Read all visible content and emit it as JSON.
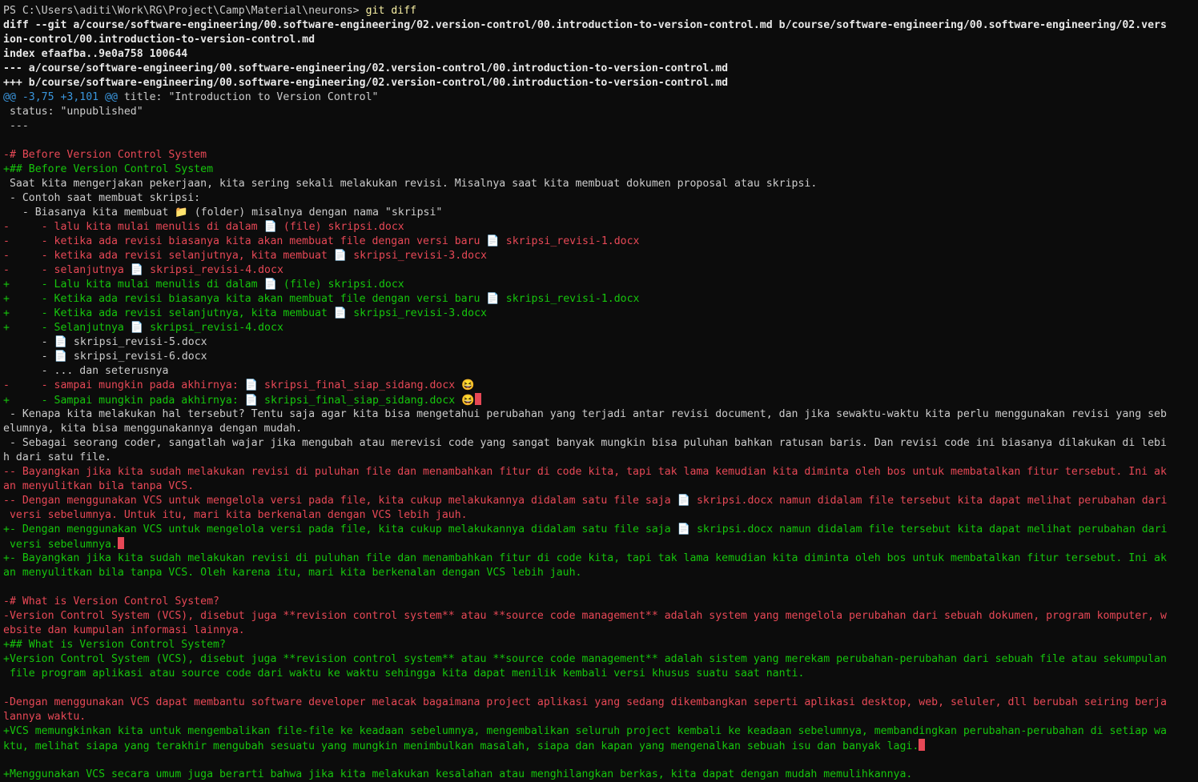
{
  "theme": {
    "background": "#0c0c0c",
    "foreground": "#cccccc",
    "command": "#f9f1a5",
    "hunk": "#3a96dd",
    "deleted": "#e74856",
    "added": "#16c60c"
  },
  "lines": [
    {
      "type": "prompt",
      "prompt": "PS C:\\Users\\aditi\\Work\\RG\\Project\\Camp\\Material\\neurons> ",
      "cmd": "git diff"
    },
    {
      "type": "meta",
      "text": "diff --git a/course/software-engineering/00.software-engineering/02.version-control/00.introduction-to-version-control.md b/course/software-engineering/00.software-engineering/02.vers"
    },
    {
      "type": "meta",
      "text": "ion-control/00.introduction-to-version-control.md"
    },
    {
      "type": "meta",
      "text": "index efaafba..9e0a758 100644"
    },
    {
      "type": "meta",
      "text": "--- a/course/software-engineering/00.software-engineering/02.version-control/00.introduction-to-version-control.md"
    },
    {
      "type": "meta",
      "text": "+++ b/course/software-engineering/00.software-engineering/02.version-control/00.introduction-to-version-control.md"
    },
    {
      "type": "hunk",
      "hunk": "@@ -3,75 +3,101 @@",
      "text": " title: \"Introduction to Version Control\""
    },
    {
      "type": "ctx",
      "text": " status: \"unpublished\""
    },
    {
      "type": "ctx",
      "text": " ---"
    },
    {
      "type": "ctx",
      "text": ""
    },
    {
      "type": "del",
      "text": "-# Before Version Control System"
    },
    {
      "type": "add",
      "text": "+## Before Version Control System"
    },
    {
      "type": "ctx",
      "text": " Saat kita mengerjakan pekerjaan, kita sering sekali melakukan revisi. Misalnya saat kita membuat dokumen proposal atau skripsi."
    },
    {
      "type": "ctx",
      "text": " - Contoh saat membuat skripsi:"
    },
    {
      "type": "ctx",
      "text": "   - Biasanya kita membuat 📁 (folder) misalnya dengan nama \"skripsi\""
    },
    {
      "type": "del",
      "text": "-     - lalu kita mulai menulis di dalam 📄 (file) skripsi.docx"
    },
    {
      "type": "del",
      "text": "-     - ketika ada revisi biasanya kita akan membuat file dengan versi baru 📄 skripsi_revisi-1.docx"
    },
    {
      "type": "del",
      "text": "-     - ketika ada revisi selanjutnya, kita membuat 📄 skripsi_revisi-3.docx"
    },
    {
      "type": "del",
      "text": "-     - selanjutnya 📄 skripsi_revisi-4.docx"
    },
    {
      "type": "add",
      "text": "+     - Lalu kita mulai menulis di dalam 📄 (file) skripsi.docx"
    },
    {
      "type": "add",
      "text": "+     - Ketika ada revisi biasanya kita akan membuat file dengan versi baru 📄 skripsi_revisi-1.docx"
    },
    {
      "type": "add",
      "text": "+     - Ketika ada revisi selanjutnya, kita membuat 📄 skripsi_revisi-3.docx"
    },
    {
      "type": "add",
      "text": "+     - Selanjutnya 📄 skripsi_revisi-4.docx"
    },
    {
      "type": "ctx",
      "text": "      - 📄 skripsi_revisi-5.docx"
    },
    {
      "type": "ctx",
      "text": "      - 📄 skripsi_revisi-6.docx"
    },
    {
      "type": "ctx",
      "text": "      - ... dan seterusnya"
    },
    {
      "type": "del",
      "text": "-     - sampai mungkin pada akhirnya: 📄 skripsi_final_siap_sidang.docx 😆"
    },
    {
      "type": "add",
      "text": "+     - Sampai mungkin pada akhirnya: 📄 skripsi_final_siap_sidang.docx 😆",
      "ws": true
    },
    {
      "type": "ctx",
      "text": " - Kenapa kita melakukan hal tersebut? Tentu saja agar kita bisa mengetahui perubahan yang terjadi antar revisi document, dan jika sewaktu-waktu kita perlu menggunakan revisi yang seb"
    },
    {
      "type": "ctx",
      "text": "elumnya, kita bisa menggunakannya dengan mudah."
    },
    {
      "type": "ctx",
      "text": " - Sebagai seorang coder, sangatlah wajar jika mengubah atau merevisi code yang sangat banyak mungkin bisa puluhan bahkan ratusan baris. Dan revisi code ini biasanya dilakukan di lebi"
    },
    {
      "type": "ctx",
      "text": "h dari satu file."
    },
    {
      "type": "del",
      "text": "-- Bayangkan jika kita sudah melakukan revisi di puluhan file dan menambahkan fitur di code kita, tapi tak lama kemudian kita diminta oleh bos untuk membatalkan fitur tersebut. Ini ak"
    },
    {
      "type": "del",
      "text": "an menyulitkan bila tanpa VCS."
    },
    {
      "type": "del",
      "text": "-- Dengan menggunakan VCS untuk mengelola versi pada file, kita cukup melakukannya didalam satu file saja 📄 skripsi.docx namun didalam file tersebut kita dapat melihat perubahan dari"
    },
    {
      "type": "del",
      "text": " versi sebelumnya. Untuk itu, mari kita berkenalan dengan VCS lebih jauh."
    },
    {
      "type": "add",
      "text": "+- Dengan menggunakan VCS untuk mengelola versi pada file, kita cukup melakukannya didalam satu file saja 📄 skripsi.docx namun didalam file tersebut kita dapat melihat perubahan dari"
    },
    {
      "type": "add",
      "text": " versi sebelumnya.",
      "ws": true
    },
    {
      "type": "add",
      "text": "+- Bayangkan jika kita sudah melakukan revisi di puluhan file dan menambahkan fitur di code kita, tapi tak lama kemudian kita diminta oleh bos untuk membatalkan fitur tersebut. Ini ak"
    },
    {
      "type": "add",
      "text": "an menyulitkan bila tanpa VCS. Oleh karena itu, mari kita berkenalan dengan VCS lebih jauh."
    },
    {
      "type": "ctx",
      "text": ""
    },
    {
      "type": "del",
      "text": "-# What is Version Control System?"
    },
    {
      "type": "del",
      "text": "-Version Control System (VCS), disebut juga **revision control system** atau **source code management** adalah system yang mengelola perubahan dari sebuah dokumen, program komputer, w"
    },
    {
      "type": "del",
      "text": "ebsite dan kumpulan informasi lainnya."
    },
    {
      "type": "add",
      "text": "+## What is Version Control System?"
    },
    {
      "type": "add",
      "text": "+Version Control System (VCS), disebut juga **revision control system** atau **source code management** adalah sistem yang merekam perubahan-perubahan dari sebuah file atau sekumpulan"
    },
    {
      "type": "add",
      "text": " file program aplikasi atau source code dari waktu ke waktu sehingga kita dapat menilik kembali versi khusus suatu saat nanti."
    },
    {
      "type": "ctx",
      "text": ""
    },
    {
      "type": "del",
      "text": "-Dengan menggunakan VCS dapat membantu software developer melacak bagaimana project aplikasi yang sedang dikembangkan seperti aplikasi desktop, web, seluler, dll berubah seiring berja"
    },
    {
      "type": "del",
      "text": "lannya waktu."
    },
    {
      "type": "add",
      "text": "+VCS memungkinkan kita untuk mengembalikan file-file ke keadaan sebelumnya, mengembalikan seluruh project kembali ke keadaan sebelumnya, membandingkan perubahan-perubahan di setiap wa"
    },
    {
      "type": "add",
      "text": "ktu, melihat siapa yang terakhir mengubah sesuatu yang mungkin menimbulkan masalah, siapa dan kapan yang mengenalkan sebuah isu dan banyak lagi.",
      "ws": true
    },
    {
      "type": "ctx",
      "text": ""
    },
    {
      "type": "add",
      "text": "+Menggunakan VCS secara umum juga berarti bahwa jika kita melakukan kesalahan atau menghilangkan berkas, kita dapat dengan mudah memulihkannya."
    }
  ]
}
